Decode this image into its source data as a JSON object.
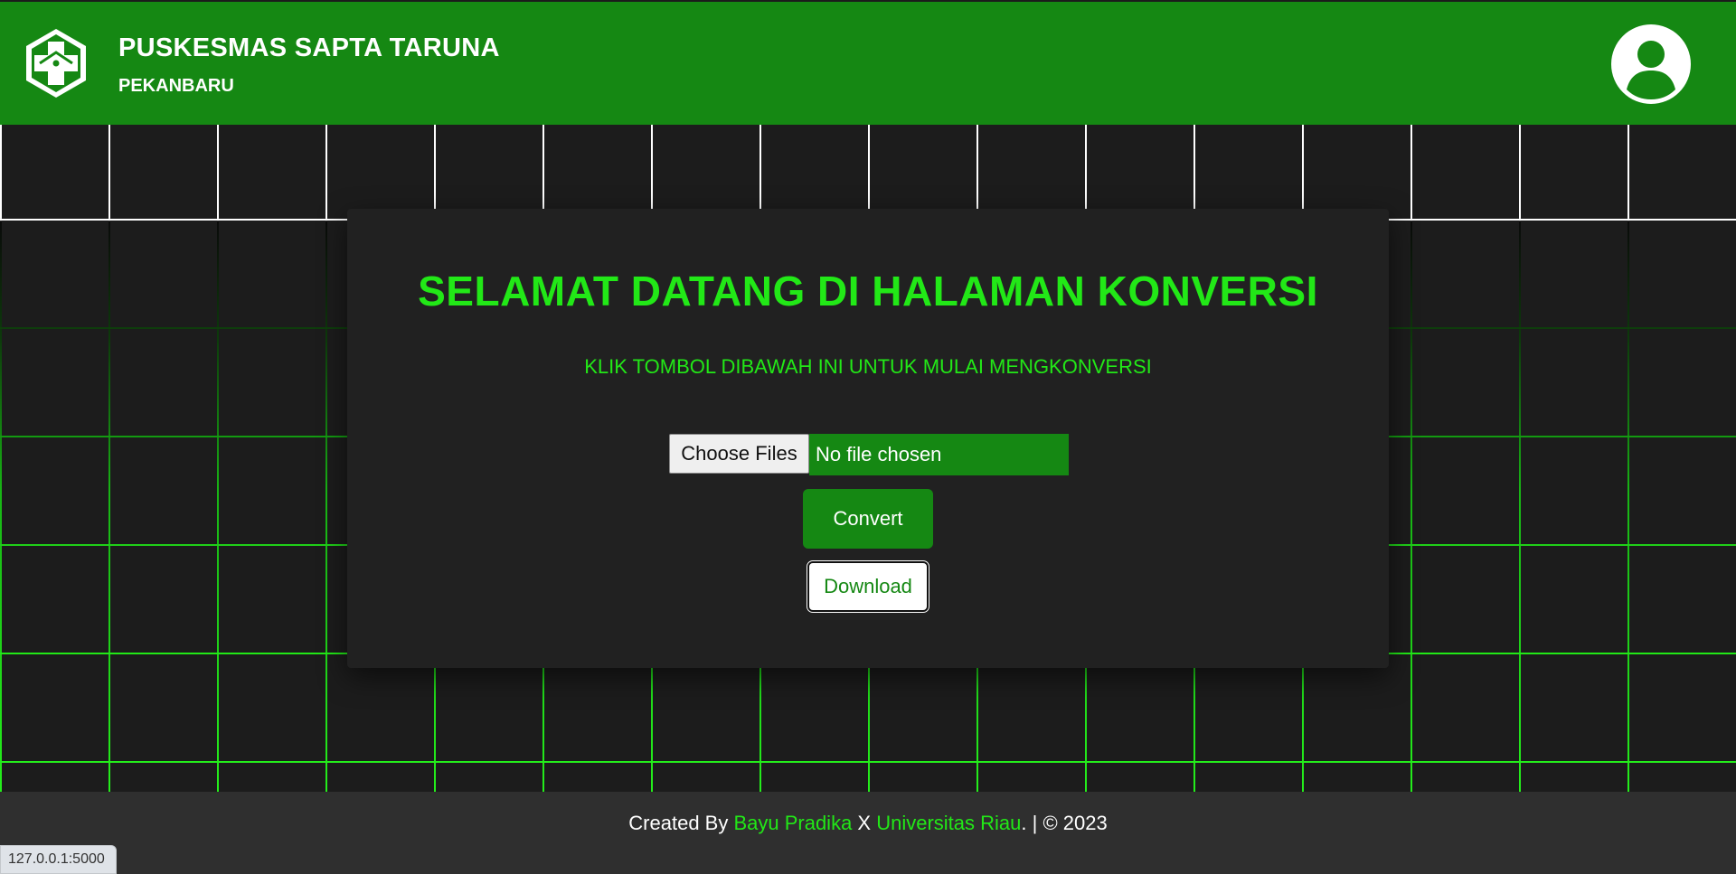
{
  "header": {
    "title": "PUSKESMAS SAPTA TARUNA",
    "subtitle": "PEKANBARU",
    "logo_icon": "puskesmas-logo",
    "profile_icon": "user-avatar-icon",
    "bg_color": "#158813"
  },
  "card": {
    "heading": "SELAMAT DATANG DI HALAMAN KONVERSI",
    "instruction": "KLIK TOMBOL DIBAWAH INI UNTUK MULAI MENGKONVERSI",
    "file_button_label": "Choose Files",
    "file_status": "No file chosen",
    "convert_label": "Convert",
    "download_label": "Download",
    "accent_color": "#22e817"
  },
  "footer": {
    "prefix": "Created By ",
    "author": "Bayu Pradika",
    "separator": " X ",
    "institution": "Universitas Riau",
    "suffix": ". | © 2023"
  },
  "status_bar": {
    "url": "127.0.0.1:5000"
  }
}
